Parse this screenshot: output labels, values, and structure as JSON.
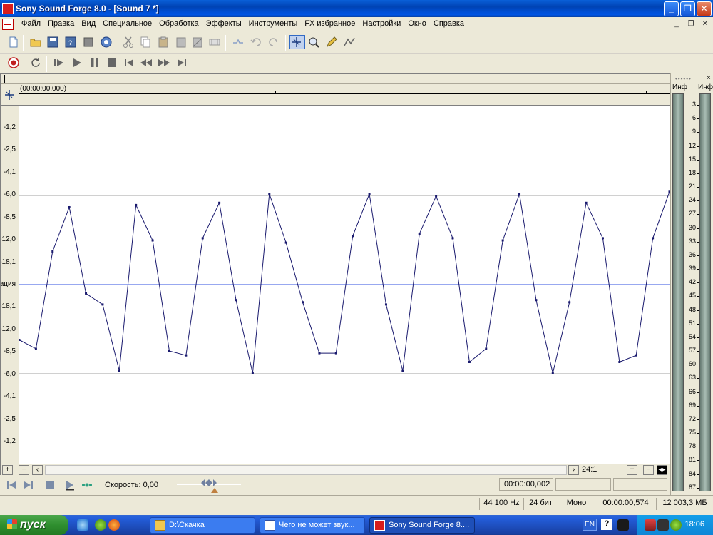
{
  "window": {
    "title": "Sony Sound Forge 8.0 - [Sound 7 *]",
    "minimize": "_",
    "maximize": "❐",
    "close": "✕"
  },
  "menu": {
    "items": [
      "Файл",
      "Правка",
      "Вид",
      "Специальное",
      "Обработка",
      "Эффекты",
      "Инструменты",
      "FX избранное",
      "Настройки",
      "Окно",
      "Справка"
    ],
    "mdi_min": "_",
    "mdi_restore": "❐",
    "mdi_close": "✕"
  },
  "ruler": {
    "time": "(00:00:00,000)"
  },
  "waveform": {
    "y_labels": [
      "-1,2",
      "-2,5",
      "-4,1",
      "-6,0",
      "-8,5",
      "-12,0",
      "-18,1",
      "ация",
      "-18,1",
      "-12,0",
      "-8,5",
      "-6,0",
      "-4,1",
      "-2,5",
      "-1,2"
    ],
    "samples": [
      -0.25,
      -0.29,
      0.15,
      0.35,
      -0.04,
      -0.09,
      -0.39,
      0.36,
      0.2,
      -0.3,
      -0.32,
      0.21,
      0.37,
      -0.07,
      -0.4,
      0.41,
      0.19,
      -0.08,
      -0.31,
      -0.31,
      0.22,
      0.41,
      -0.09,
      -0.39,
      0.23,
      0.4,
      0.21,
      -0.35,
      -0.29,
      0.2,
      0.41,
      -0.07,
      -0.4,
      -0.08,
      0.37,
      0.21,
      -0.35,
      -0.32,
      0.21,
      0.42
    ],
    "colors": {
      "wave": "#1a1a6e",
      "center": "#3050e0",
      "guide": "#a0a0a0"
    }
  },
  "scroll": {
    "plus": "+",
    "minus": "−",
    "zoom_ratio": "24:1",
    "zoom_plus": "+",
    "zoom_minus": "−"
  },
  "playbar": {
    "speed_label": "Скорость: 0,00",
    "cursor_time": "00:00:00,002"
  },
  "statusbar": {
    "sample_rate": "44 100 Hz",
    "bit_depth": "24 бит",
    "channels": "Моно",
    "length": "00:00:00,574",
    "free_space": "12 003,3 МБ"
  },
  "meters": {
    "grip": "••••••",
    "close": "×",
    "left_head": "Инф",
    "right_head": "Инф",
    "scale": [
      "3",
      "6",
      "9",
      "12",
      "15",
      "18",
      "21",
      "24",
      "27",
      "30",
      "33",
      "36",
      "39",
      "42",
      "45",
      "48",
      "51",
      "54",
      "57",
      "60",
      "63",
      "66",
      "69",
      "72",
      "75",
      "78",
      "81",
      "84",
      "87"
    ]
  },
  "taskbar": {
    "start_label": "пуск",
    "tasks": [
      {
        "label": "D:\\Скачка",
        "icon": "folder-icon"
      },
      {
        "label": "Чего не может звук...",
        "icon": "document-icon"
      },
      {
        "label": "Sony Sound Forge 8....",
        "icon": "sound-forge-icon"
      }
    ],
    "language": "EN",
    "help": "?",
    "clock": "18:06"
  }
}
